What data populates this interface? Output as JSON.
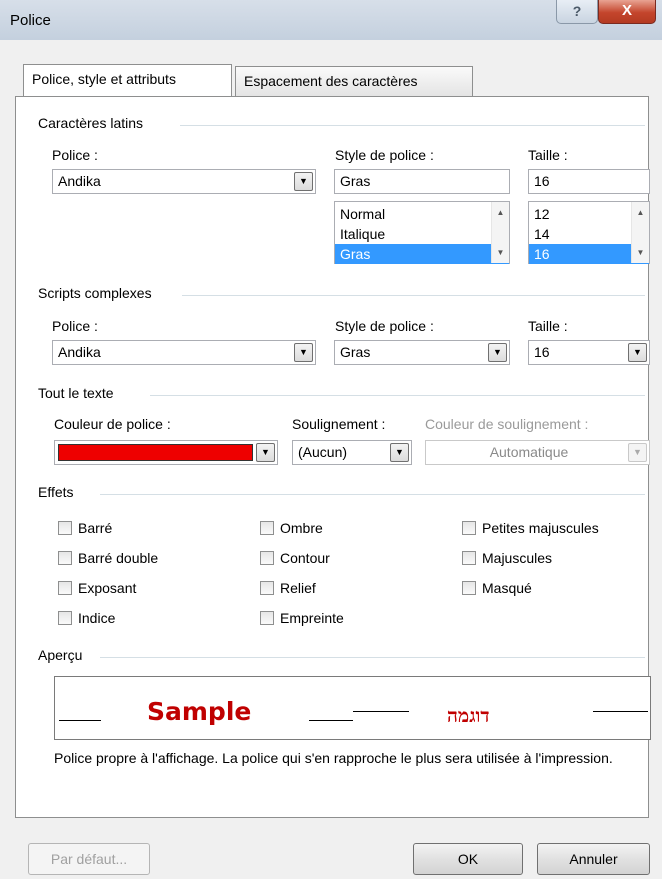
{
  "window": {
    "title": "Police",
    "help_glyph": "?",
    "close_glyph": "X"
  },
  "tabs": [
    {
      "label": "Police, style et attributs",
      "active": true
    },
    {
      "label": "Espacement des caractères",
      "active": false
    }
  ],
  "latin": {
    "group_label": "Caractères latins",
    "font_label": "Police :",
    "font_value": "Andika",
    "style_label": "Style de police :",
    "style_value": "Gras",
    "style_options": [
      "Normal",
      "Italique",
      "Gras"
    ],
    "size_label": "Taille :",
    "size_value": "16",
    "size_options": [
      "12",
      "14",
      "16"
    ]
  },
  "complex": {
    "group_label": "Scripts complexes",
    "font_label": "Police :",
    "font_value": "Andika",
    "style_label": "Style de police :",
    "style_value": "Gras",
    "size_label": "Taille :",
    "size_value": "16"
  },
  "all_text": {
    "group_label": "Tout le texte",
    "color_label": "Couleur de police :",
    "color_value": "#ee0000",
    "underline_label": "Soulignement :",
    "underline_value": "(Aucun)",
    "underline_color_label": "Couleur de soulignement :",
    "underline_color_value": "Automatique"
  },
  "effects": {
    "group_label": "Effets",
    "col1": [
      "Barré",
      "Barré double",
      "Exposant",
      "Indice"
    ],
    "col2": [
      "Ombre",
      "Contour",
      "Relief",
      "Empreinte"
    ],
    "col3": [
      "Petites majuscules",
      "Majuscules",
      "Masqué"
    ]
  },
  "preview": {
    "group_label": "Aperçu",
    "sample_latin": "Sample",
    "sample_hebrew": "דוגמה",
    "note": "Police propre à l'affichage. La police qui s'en rapproche le plus sera utilisée à l'impression."
  },
  "buttons": {
    "default": "Par défaut...",
    "ok": "OK",
    "cancel": "Annuler"
  },
  "colors": {
    "selection": "#3399ff",
    "sample_text": "#c00000"
  }
}
